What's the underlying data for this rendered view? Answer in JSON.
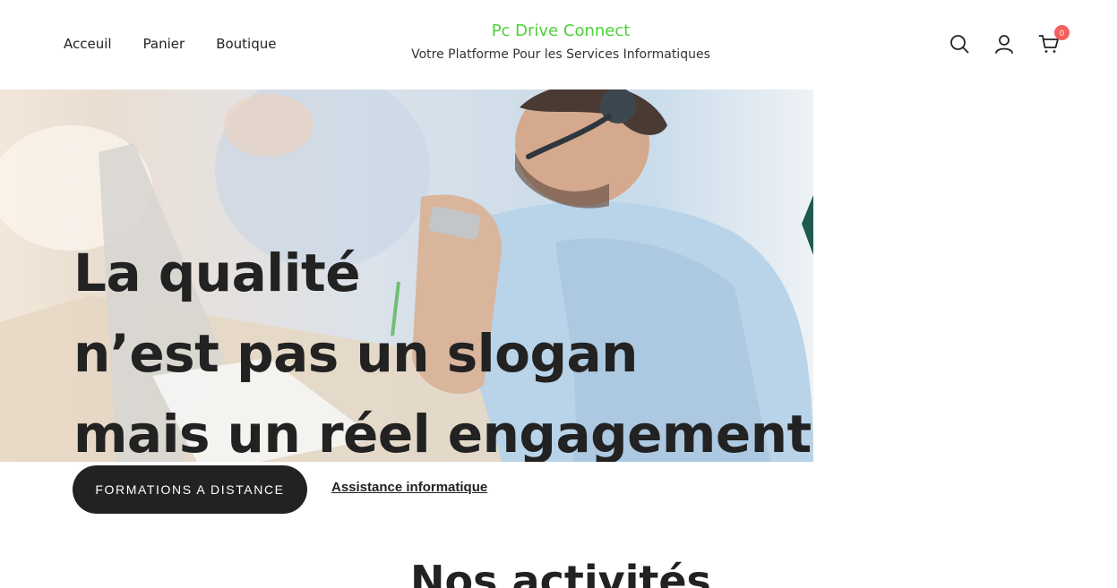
{
  "header": {
    "nav": [
      "Acceuil",
      "Panier",
      "Boutique"
    ],
    "brand_title": "Pc Drive Connect",
    "brand_tagline": "Votre Platforme Pour les Services Informatiques",
    "cart_count": "0",
    "icons": [
      "search-icon",
      "user-icon",
      "cart-icon"
    ]
  },
  "hero": {
    "line1": "La qualité",
    "line2": "n’est pas un slogan",
    "line3": "mais un réel engagement"
  },
  "actions": {
    "cta_label": "FORMATIONS A DISTANCE",
    "link_label": "Assistance informatique"
  },
  "section": {
    "title": "Nos activités"
  },
  "colors": {
    "brand": "#4cd137",
    "badge": "#f25f5c",
    "dark": "#222222"
  }
}
